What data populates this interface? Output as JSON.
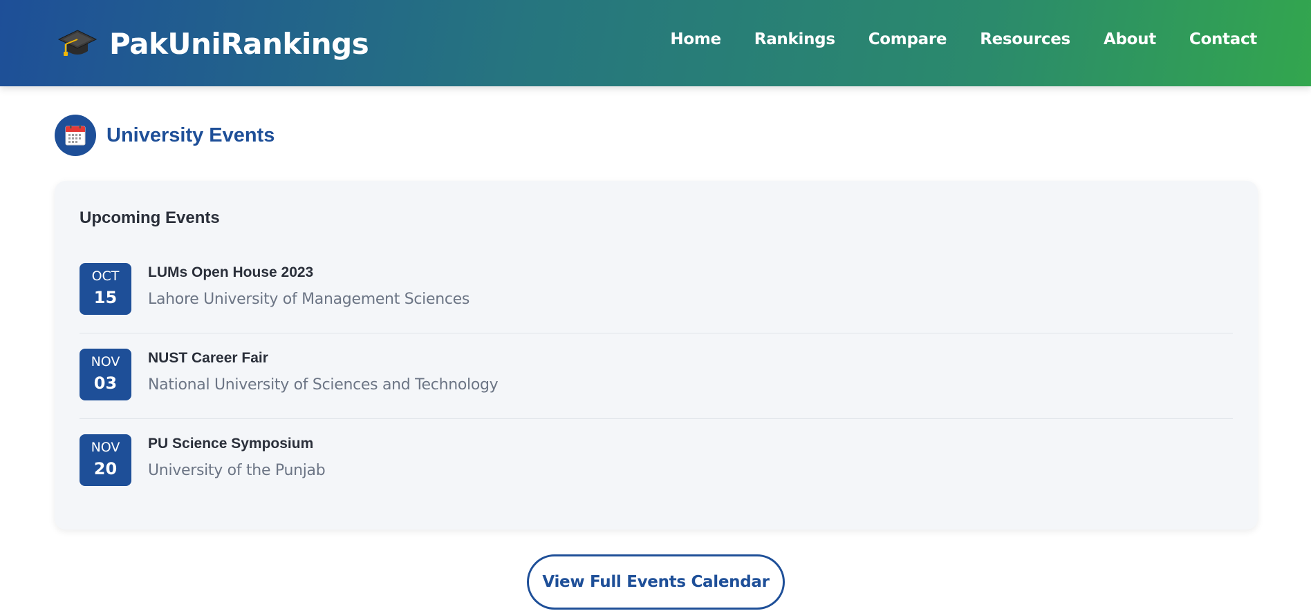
{
  "header": {
    "brand_icon": "graduation-cap-icon",
    "brand_name": "PakUniRankings",
    "nav": [
      {
        "label": "Home"
      },
      {
        "label": "Rankings"
      },
      {
        "label": "Compare"
      },
      {
        "label": "Resources"
      },
      {
        "label": "About"
      },
      {
        "label": "Contact"
      }
    ]
  },
  "section": {
    "icon": "calendar-icon",
    "title": "University Events"
  },
  "events_card": {
    "title": "Upcoming Events",
    "events": [
      {
        "month": "OCT",
        "day": "15",
        "name": "LUMs Open House 2023",
        "university": "Lahore University of Management Sciences"
      },
      {
        "month": "NOV",
        "day": "03",
        "name": "NUST Career Fair",
        "university": "National University of Sciences and Technology"
      },
      {
        "month": "NOV",
        "day": "20",
        "name": "PU Science Symposium",
        "university": "University of the Punjab"
      }
    ]
  },
  "cta": {
    "label": "View Full Events Calendar"
  },
  "colors": {
    "primary": "#1e4f98",
    "header_gradient_start": "#1e4f98",
    "header_gradient_end": "#33a64e",
    "card_background": "#f4f6f9",
    "muted_text": "#6c7585"
  }
}
